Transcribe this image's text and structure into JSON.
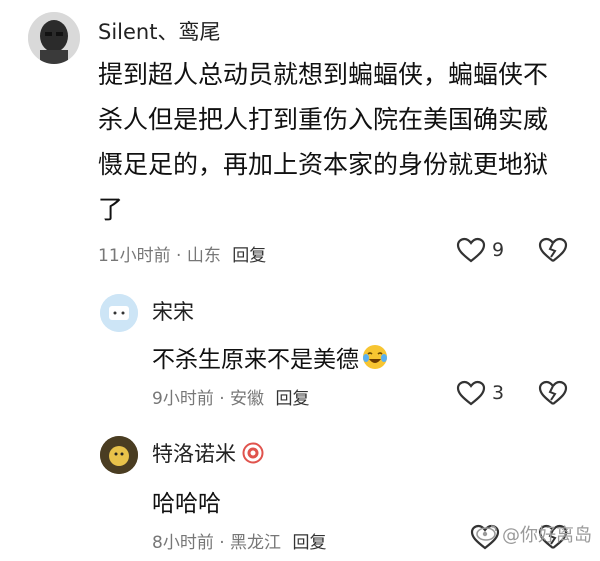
{
  "comments": [
    {
      "username": "Silent、鸾尾",
      "text_lines": [
        "提到超人总动员就想到蝙蝠侠，蝙蝠侠不",
        "杀人但是把人打到重伤入院在美国确实威",
        "慑足足的，再加上资本家的身份就更地狱",
        "了"
      ],
      "time": "11小时前",
      "location": "山东",
      "reply_label": "回复",
      "like_count": "9"
    },
    {
      "username": "宋宋",
      "text": "不杀生原来不是美德",
      "emoji": "crying-laughing-emoji",
      "time": "9小时前",
      "location": "安徽",
      "reply_label": "回复",
      "like_count": "3"
    },
    {
      "username": "特洛诺米",
      "text": "哈哈哈",
      "time": "8小时前",
      "location": "黑龙江",
      "reply_label": "回复",
      "like_count": ""
    }
  ],
  "watermark": "@你好离岛",
  "colors": {
    "meta": "#777777",
    "text": "#111111",
    "badge": "#e0534d"
  }
}
